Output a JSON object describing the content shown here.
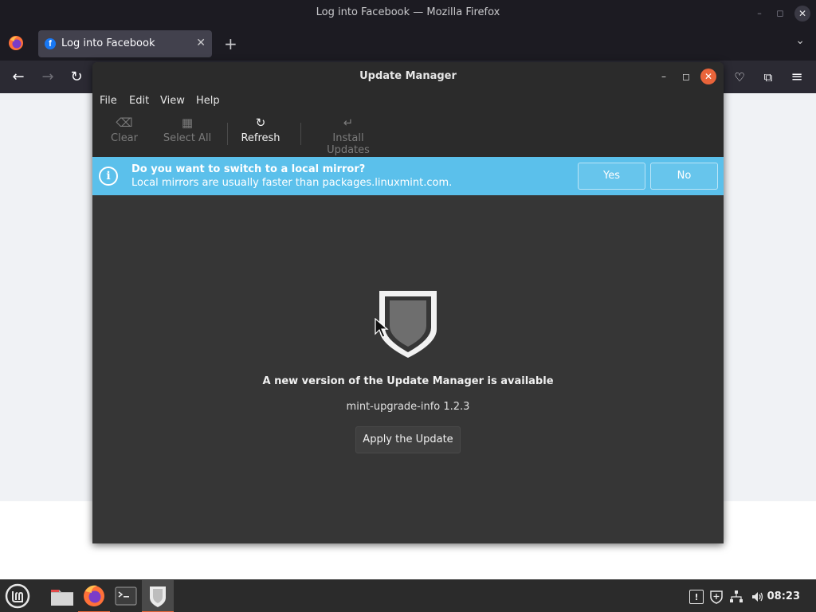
{
  "firefox": {
    "window_title": "Log into Facebook — Mozilla Firefox",
    "tab": {
      "title": "Log into Facebook",
      "favicon": "f",
      "close": "✕"
    },
    "new_tab": "+",
    "window_controls": {
      "minimize": "–",
      "maximize": "◻",
      "close": "✕"
    }
  },
  "update_manager": {
    "title": "Update Manager",
    "window_controls": {
      "minimize": "–",
      "maximize": "◻",
      "close": "✕"
    },
    "menu": [
      "File",
      "Edit",
      "View",
      "Help"
    ],
    "toolbar": {
      "clear": "Clear",
      "select_all": "Select All",
      "refresh": "Refresh",
      "install_updates": "Install Updates"
    },
    "infobar": {
      "icon": "i",
      "title": "Do you want to switch to a local mirror?",
      "subtitle": "Local mirrors are usually faster than packages.linuxmint.com.",
      "yes": "Yes",
      "no": "No"
    },
    "message": {
      "title": "A new version of the Update Manager is available",
      "version": "mint-upgrade-info 1.2.3",
      "button": "Apply the Update"
    }
  },
  "taskbar": {
    "clock": "08:23",
    "apps": [
      "menu-icon",
      "files-icon",
      "firefox-icon",
      "terminal-icon",
      "update-manager-icon"
    ],
    "tray": [
      "notes-icon",
      "shield-tray-icon",
      "network-icon",
      "volume-icon"
    ]
  },
  "colors": {
    "accent": "#e9643a",
    "infobar": "#5bc0eb",
    "facebook_blue": "#1877f2"
  }
}
